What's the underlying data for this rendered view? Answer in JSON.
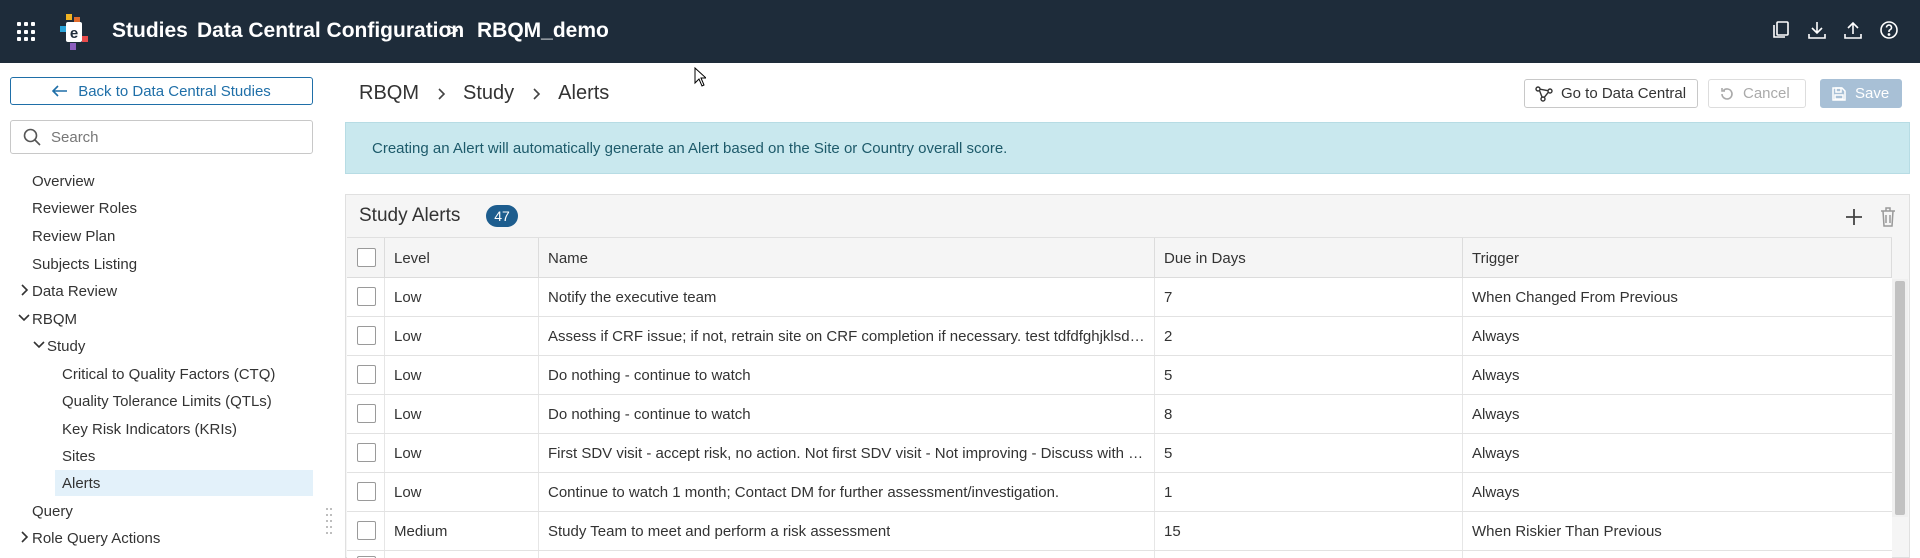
{
  "topbar": {
    "app_name": "Studies",
    "crumb_parent": "Data Central Configuration",
    "crumb_separator": ">",
    "crumb_current": "RBQM_demo",
    "icons": [
      "apps-grid-icon",
      "copy-icon",
      "download-icon",
      "upload-icon",
      "help-icon"
    ]
  },
  "sidebar": {
    "back_label": "Back to Data Central Studies",
    "search_placeholder": "Search",
    "items": [
      {
        "label": "Overview"
      },
      {
        "label": "Reviewer Roles"
      },
      {
        "label": "Review Plan"
      },
      {
        "label": "Subjects Listing"
      },
      {
        "label": "Data Review",
        "expander": "collapsed"
      },
      {
        "label": "RBQM",
        "expander": "expanded"
      },
      {
        "label": "Study",
        "expander": "expanded"
      },
      {
        "label": "Critical to Quality Factors (CTQ)"
      },
      {
        "label": "Quality Tolerance Limits (QTLs)"
      },
      {
        "label": "Key Risk Indicators (KRIs)"
      },
      {
        "label": "Sites"
      },
      {
        "label": "Alerts",
        "selected": true
      },
      {
        "label": "Query"
      },
      {
        "label": "Role Query Actions",
        "expander": "collapsed"
      }
    ]
  },
  "page": {
    "breadcrumb": [
      "RBQM",
      "Study",
      "Alerts"
    ],
    "go_to_central_label": "Go to Data Central",
    "cancel_label": "Cancel",
    "save_label": "Save",
    "info_message": "Creating an Alert will automatically generate an Alert based on the Site or Country overall score."
  },
  "alerts": {
    "title": "Study Alerts",
    "count": "47",
    "columns": {
      "level": "Level",
      "name": "Name",
      "due": "Due in Days",
      "trigger": "Trigger"
    },
    "rows": [
      {
        "level": "Low",
        "name": "Notify the executive team",
        "due": "7",
        "trigger": "When Changed From Previous"
      },
      {
        "level": "Low",
        "name": "Assess if CRF issue; if not, retrain site on CRF completion if necessary. test tdfdfghjklsdfghjkl",
        "due": "2",
        "trigger": "Always"
      },
      {
        "level": "Low",
        "name": "Do nothing - continue to watch",
        "due": "5",
        "trigger": "Always"
      },
      {
        "level": "Low",
        "name": "Do nothing - continue to watch",
        "due": "8",
        "trigger": "Always"
      },
      {
        "level": "Low",
        "name": "First SDV visit - accept risk, no action. Not first SDV visit - Not improving - Discuss with Study Team",
        "due": "5",
        "trigger": "Always"
      },
      {
        "level": "Low",
        "name": "Continue to watch 1 month; Contact DM for further assessment/investigation.",
        "due": "1",
        "trigger": "Always"
      },
      {
        "level": "Medium",
        "name": "Study Team to meet and perform a risk assessment",
        "due": "15",
        "trigger": "When Riskier Than Previous"
      }
    ]
  },
  "colors": {
    "topbar_bg": "#1e2c3a",
    "accent": "#1f6fa8",
    "info_bg": "#c9e8ee",
    "badge_bg": "#1d5d8e",
    "selected_nav_bg": "#e3f1fa"
  }
}
